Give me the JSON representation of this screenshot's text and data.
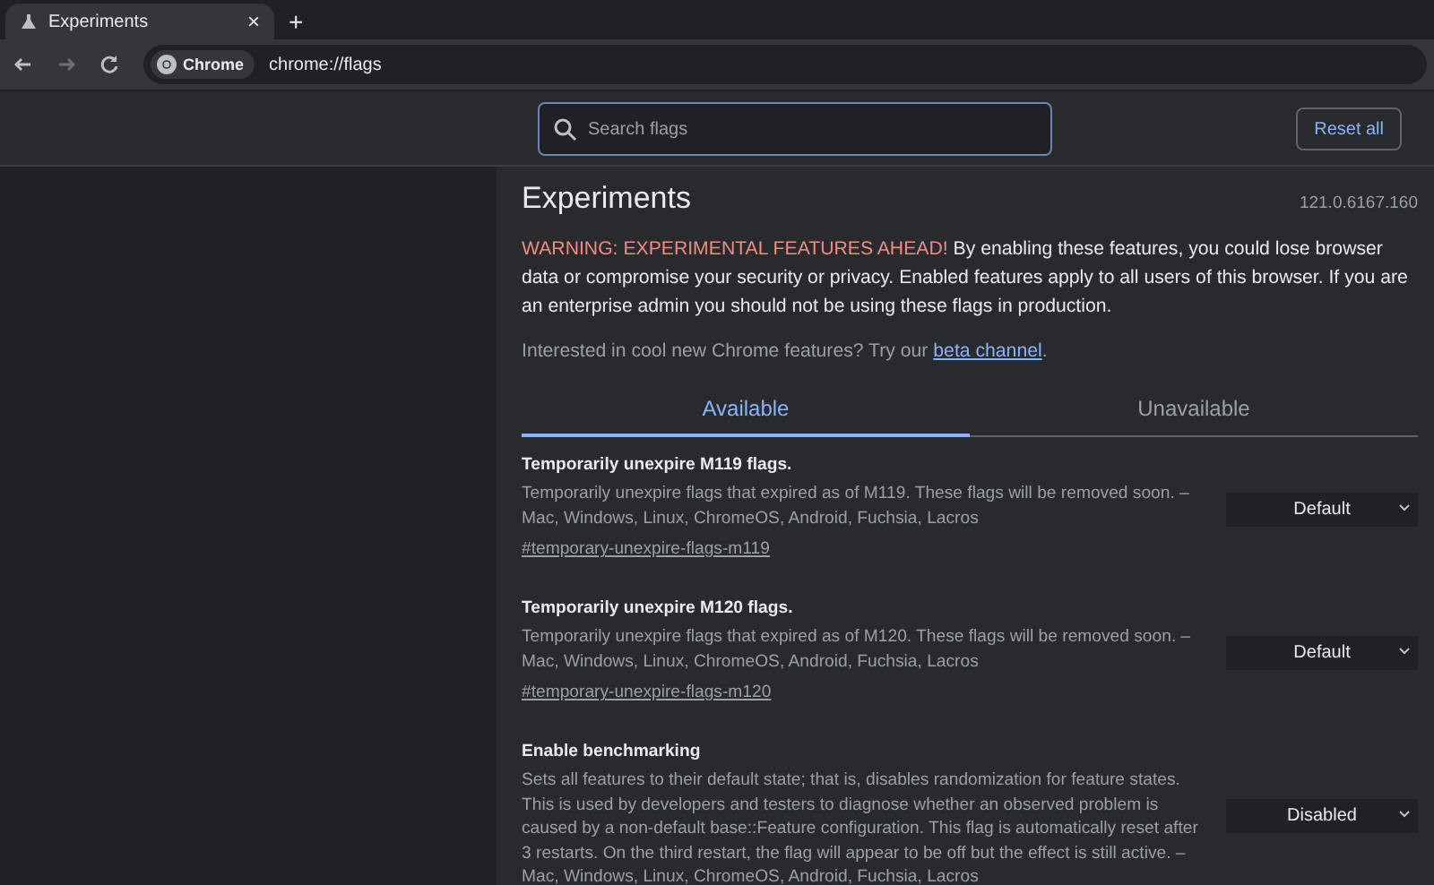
{
  "browser": {
    "tab": {
      "title": "Experiments",
      "close": "×"
    },
    "new_tab": "+",
    "omnibox": {
      "chip": "Chrome",
      "url": "chrome://flags"
    }
  },
  "header": {
    "search": {
      "placeholder": "Search flags"
    },
    "reset_button": "Reset all"
  },
  "page": {
    "title": "Experiments",
    "version": "121.0.6167.160",
    "warning_label": "WARNING: EXPERIMENTAL FEATURES AHEAD!",
    "warning_text": "By enabling these features, you could lose browser data or compromise your security or privacy. Enabled features apply to all users of this browser. If you are an enterprise admin you should not be using these flags in production.",
    "intro_before": "Interested in cool new Chrome features? Try our",
    "intro_link": "beta channel",
    "intro_after": ".",
    "tabs": [
      {
        "label": "Available",
        "selected": true
      },
      {
        "label": "Unavailable",
        "selected": false
      }
    ],
    "flags": [
      {
        "name": "Temporarily unexpire M119 flags.",
        "description": "Temporarily unexpire flags that expired as of M119. These flags will be removed soon. – Mac, Windows, Linux, ChromeOS, Android, Fuchsia, Lacros",
        "link": "#temporary-unexpire-flags-m119",
        "value": "Default"
      },
      {
        "name": "Temporarily unexpire M120 flags.",
        "description": "Temporarily unexpire flags that expired as of M120. These flags will be removed soon. – Mac, Windows, Linux, ChromeOS, Android, Fuchsia, Lacros",
        "link": "#temporary-unexpire-flags-m120",
        "value": "Default"
      },
      {
        "name": "Enable benchmarking",
        "description": "Sets all features to their default state; that is, disables randomization for feature states. This is used by developers and testers to diagnose whether an observed problem is caused by a non-default base::Feature configuration. This flag is automatically reset after 3 restarts. On the third restart, the flag will appear to be off but the effect is still active. – Mac, Windows, Linux, ChromeOS, Android, Fuchsia, Lacros",
        "value": "Disabled"
      }
    ]
  }
}
